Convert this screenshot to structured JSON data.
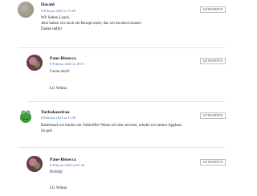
{
  "reply_label": "ANTWORTEN",
  "comments": [
    {
      "author": "Harald",
      "date": "8 Februar 2023 at 15:09",
      "lines": [
        "Wir lieben Lauch.",
        "Jetzt haben wir noch ein Rezept mehr, das wir kochen können!",
        "Danke dafür!"
      ]
    },
    {
      "author": "Pane-Bistecca",
      "date": "8 Februar 2023 at 18:51",
      "lines": [
        "Gerne doch!",
        "",
        "LG Wilma"
      ]
    },
    {
      "author": "Turbohausfrau",
      "date": "8 Februar 2023 at 11:39",
      "lines": [
        "Rahmlauch ist immer ein Volltreffer! Wenn ich den serviere, erhalte ich immer Applaus.",
        "So gut!"
      ]
    },
    {
      "author": "Pane-Bistecca",
      "date": "8 Februar 2023 at 07:42",
      "lines": [
        "Richtig!",
        "",
        "LG Wilma"
      ]
    }
  ]
}
